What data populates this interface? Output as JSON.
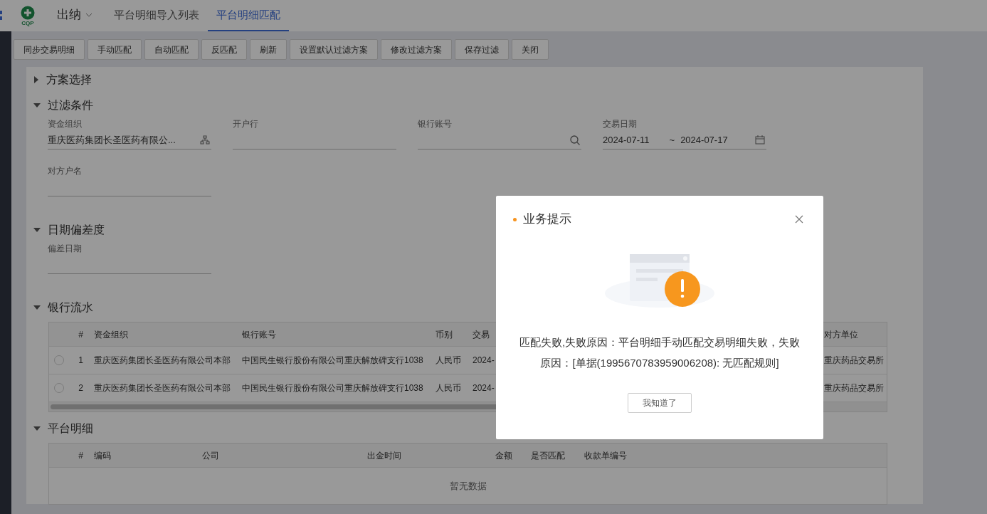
{
  "header": {
    "logo_text": "CQP",
    "module": "出纳",
    "tabs": [
      {
        "label": "平台明细导入列表",
        "selected": false
      },
      {
        "label": "平台明细匹配",
        "selected": true
      }
    ]
  },
  "toolbar": [
    "同步交易明细",
    "手动匹配",
    "自动匹配",
    "反匹配",
    "刷新",
    "设置默认过滤方案",
    "修改过滤方案",
    "保存过滤",
    "关闭"
  ],
  "sections": [
    {
      "title": "方案选择",
      "expanded": false
    },
    {
      "title": "过滤条件",
      "expanded": true,
      "kind": "form",
      "fields": [
        {
          "label": "资金组织",
          "kind": "tree",
          "value": "重庆医药集团长圣医药有限公..."
        },
        {
          "label": "开户行",
          "kind": "text"
        },
        {
          "label": "银行账号",
          "kind": "search"
        },
        {
          "label": "交易日期",
          "kind": "daterange",
          "start": "2024-07-11",
          "separator": "~",
          "end": "2024-07-17"
        },
        {
          "label": "对方户名",
          "kind": "text"
        }
      ]
    },
    {
      "title": "日期偏差度",
      "expanded": true,
      "kind": "form",
      "fields": [
        {
          "label": "偏差日期",
          "kind": "text"
        }
      ]
    },
    {
      "title": "银行流水",
      "expanded": true,
      "kind": "table",
      "table": {
        "columns": [
          "#",
          "资金组织",
          "银行账号",
          "币别",
          "交易",
          "对方单位"
        ],
        "rows": [
          {
            "selected": false,
            "cells": [
              "1",
              "重庆医药集团长圣医药有限公司本部",
              "中国民生银行股份有限公司重庆解放碑支行1038",
              "人民币",
              "2024-",
              "重庆药品交易所"
            ]
          },
          {
            "selected": false,
            "cells": [
              "2",
              "重庆医药集团长圣医药有限公司本部",
              "中国民生银行股份有限公司重庆解放碑支行1038",
              "人民币",
              "2024-",
              "重庆药品交易所"
            ]
          }
        ]
      }
    },
    {
      "title": "平台明细",
      "expanded": true,
      "kind": "table",
      "table": {
        "columns": [
          "#",
          "编码",
          "公司",
          "出金时间",
          "金额",
          "是否匹配",
          "收款单编号"
        ],
        "empty_text": "暂无数据"
      }
    }
  ],
  "dialog": {
    "title": "业务提示",
    "message": "匹配失败,失败原因：平台明细手动匹配交易明细失败，失败原因：[单据(1995670783959006208): 无匹配规则]",
    "button": "我知道了"
  }
}
